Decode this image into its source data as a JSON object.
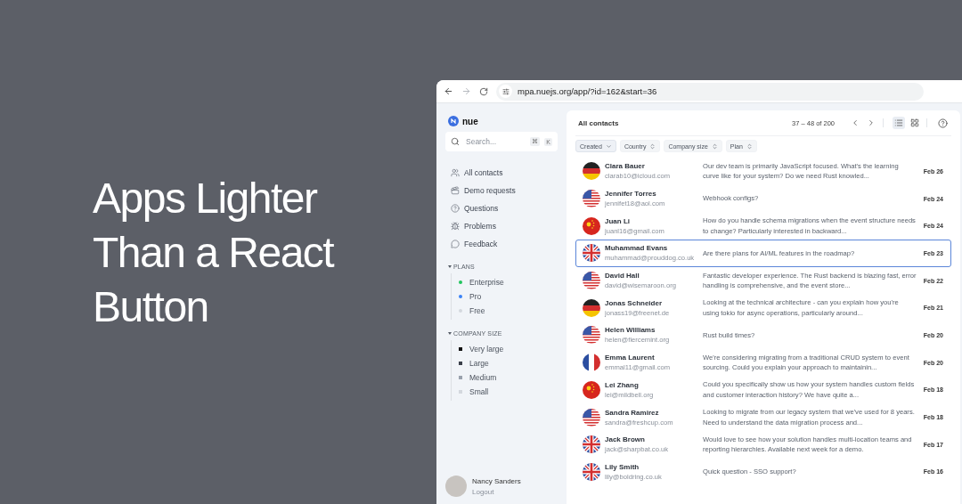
{
  "headline": "Apps Lighter Than a React Button",
  "browser": {
    "url": "mpa.nuejs.org/app/?id=162&start=36"
  },
  "sidebar": {
    "logo": "nue",
    "search": {
      "placeholder": "Search...",
      "shortcut": [
        "⌘",
        "K"
      ]
    },
    "nav": [
      {
        "kind": "contacts",
        "label": "All contacts"
      },
      {
        "kind": "demo",
        "label": "Demo requests"
      },
      {
        "kind": "questions",
        "label": "Questions"
      },
      {
        "kind": "problems",
        "label": "Problems"
      },
      {
        "kind": "feedback",
        "label": "Feedback"
      }
    ],
    "groups": [
      {
        "title": "PLANS",
        "expanded": true,
        "kind": "dot",
        "items": [
          {
            "label": "Enterprise",
            "color": "#22c55e"
          },
          {
            "label": "Pro",
            "color": "#3b82f6"
          },
          {
            "label": "Free",
            "color": "#d4d8de"
          }
        ]
      },
      {
        "title": "COMPANY SIZE",
        "expanded": true,
        "kind": "square",
        "items": [
          {
            "label": "Very large",
            "color": "#111111"
          },
          {
            "label": "Large",
            "color": "#3a3f4a"
          },
          {
            "label": "Medium",
            "color": "#9aa1ad"
          },
          {
            "label": "Small",
            "color": "#d4d8de"
          }
        ]
      }
    ],
    "user": {
      "name": "Nancy Sanders",
      "action": "Logout"
    }
  },
  "main": {
    "title": "All contacts",
    "range": "37 – 48 of 200",
    "view_buttons": [
      {
        "kind": "list",
        "selected": true
      },
      {
        "kind": "grid",
        "selected": false
      }
    ],
    "filters": [
      {
        "label": "Created",
        "selected": true
      },
      {
        "label": "Country",
        "selected": false
      },
      {
        "label": "Company size",
        "selected": false
      },
      {
        "label": "Plan",
        "selected": false
      }
    ],
    "rows": [
      {
        "kind": "de",
        "name": "Clara Bauer",
        "email": "clarab10@icloud.com",
        "message": "Our dev team is primarily JavaScript focused. What's the learning curve like for your system? Do we need Rust knowled...",
        "date": "Feb 26",
        "selected": false
      },
      {
        "kind": "us",
        "name": "Jennifer Torres",
        "email": "jennifet18@aol.com",
        "message": "Webhook configs?",
        "date": "Feb 24",
        "selected": false
      },
      {
        "kind": "cn",
        "name": "Juan Li",
        "email": "juanl16@gmail.com",
        "message": "How do you handle schema migrations when the event structure needs to change? Particularly interested in backward...",
        "date": "Feb 24",
        "selected": false
      },
      {
        "kind": "gb",
        "name": "Muhammad Evans",
        "email": "muhammad@prouddog.co.uk",
        "message": "Are there plans for AI/ML features in the roadmap?",
        "date": "Feb 23",
        "selected": true
      },
      {
        "kind": "us",
        "name": "David Hall",
        "email": "david@wisemaroon.org",
        "message": "Fantastic developer experience. The Rust backend is blazing fast, error handling is comprehensive, and the event store...",
        "date": "Feb 22",
        "selected": false
      },
      {
        "kind": "de",
        "name": "Jonas Schneider",
        "email": "jonass19@freenet.de",
        "message": "Looking at the technical architecture - can you explain how you're using tokio for async operations, particularly around...",
        "date": "Feb 21",
        "selected": false
      },
      {
        "kind": "us",
        "name": "Helen Williams",
        "email": "helen@fiercemint.org",
        "message": "Rust build times?",
        "date": "Feb 20",
        "selected": false
      },
      {
        "kind": "fr",
        "name": "Emma Laurent",
        "email": "emmal11@gmail.com",
        "message": "We're considering migrating from a traditional CRUD system to event sourcing. Could you explain your approach to maintainin...",
        "date": "Feb 20",
        "selected": false
      },
      {
        "kind": "cn",
        "name": "Lei Zhang",
        "email": "lei@mildbell.org",
        "message": "Could you specifically show us how your system handles custom fields and customer interaction history? We have quite a...",
        "date": "Feb 18",
        "selected": false
      },
      {
        "kind": "us",
        "name": "Sandra Ramirez",
        "email": "sandra@freshcup.com",
        "message": "Looking to migrate from our legacy system that we've used for 8 years. Need to understand the data migration process and...",
        "date": "Feb 18",
        "selected": false
      },
      {
        "kind": "gb",
        "name": "Jack Brown",
        "email": "jack@sharpbat.co.uk",
        "message": "Would love to see how your solution handles multi-location teams and reporting hierarchies. Available next week for a demo.",
        "date": "Feb 17",
        "selected": false
      },
      {
        "kind": "gb",
        "name": "Lily Smith",
        "email": "lily@boldring.co.uk",
        "message": "Quick question - SSO support?",
        "date": "Feb 16",
        "selected": false
      }
    ]
  }
}
